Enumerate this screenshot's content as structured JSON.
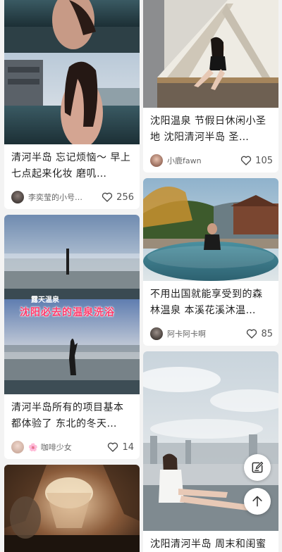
{
  "cards_left": [
    {
      "title": "清河半岛 忘记烦恼～ 早上七点起来化妆 磨叽…",
      "author": "李奕莹的小号…",
      "likes": "256"
    },
    {
      "overlay_label": "露天温泉",
      "overlay_caption": "沈阳必去的温泉洗浴",
      "title": "清河半岛所有的项目基本都体验了 东北的冬天…",
      "author_badge": "🌸",
      "author": "咖啡少女",
      "likes": "14"
    },
    {
      "title": ""
    }
  ],
  "cards_right": [
    {
      "title": "沈阳温泉 节假日休闲小圣地 沈阳清河半岛 圣…",
      "author": "小鹿fawn",
      "likes": "105"
    },
    {
      "title": "不用出国就能享受到的森林温泉 本溪花溪沐温…",
      "author": "阿卡阿卡啊",
      "likes": "85"
    },
    {
      "title": "沈阳清河半岛 周末和闺蜜来的 门口有停车场"
    }
  ],
  "icons": {
    "heart": "heart-icon",
    "edit": "edit-note-icon",
    "top": "arrow-up-icon"
  },
  "colors": {
    "background": "#f3f3f3",
    "card": "#ffffff",
    "title_text": "#1f1f1f",
    "meta_text": "#666666",
    "caption_pink": "#ff3b6b"
  }
}
